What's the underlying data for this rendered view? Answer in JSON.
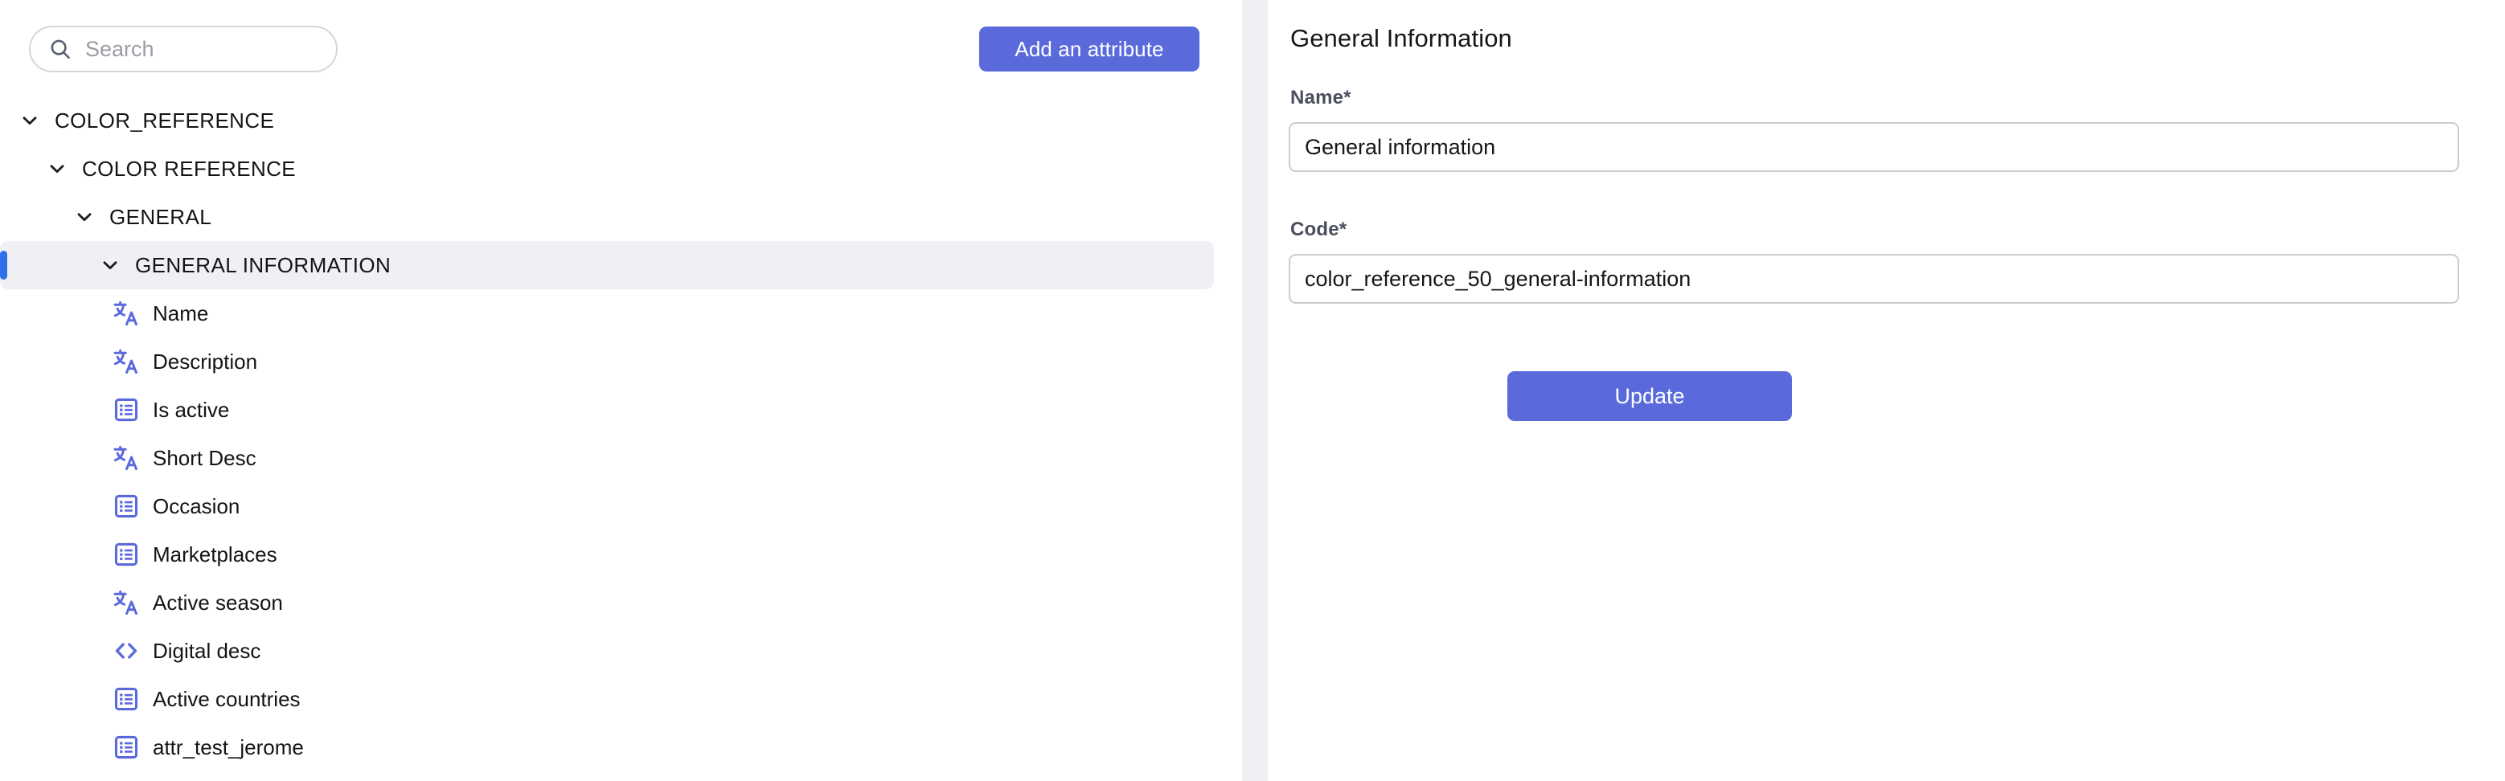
{
  "colors": {
    "accent": "#5a6adb",
    "icon_blue": "#5a6adb",
    "selection_bar": "#2f70e8",
    "selection_bg": "#eff0f4",
    "divider": "#eff0f4",
    "border": "#c9cbd2",
    "text": "#131416",
    "label": "#4a4f5c",
    "placeholder": "#9b9da6"
  },
  "left_panel": {
    "search": {
      "value": "",
      "placeholder": "Search",
      "icon": "search-icon"
    },
    "add_attribute_button": {
      "label": "Add an attribute"
    },
    "tree": [
      {
        "label": "COLOR_REFERENCE",
        "kind": "group",
        "depth": 0,
        "expanded": true,
        "chevron": "chevron-down-icon",
        "selected": false
      },
      {
        "label": "COLOR REFERENCE",
        "kind": "group",
        "depth": 1,
        "expanded": true,
        "chevron": "chevron-down-icon",
        "selected": false
      },
      {
        "label": "GENERAL",
        "kind": "group",
        "depth": 2,
        "expanded": true,
        "chevron": "chevron-down-icon",
        "selected": false
      },
      {
        "label": "GENERAL INFORMATION",
        "kind": "group",
        "depth": 3,
        "expanded": true,
        "chevron": "chevron-down-icon",
        "selected": true
      },
      {
        "label": "Name",
        "kind": "attribute",
        "depth": 4,
        "icon": "translate-icon",
        "selected": false
      },
      {
        "label": "Description",
        "kind": "attribute",
        "depth": 4,
        "icon": "translate-icon",
        "selected": false
      },
      {
        "label": "Is active",
        "kind": "attribute",
        "depth": 4,
        "icon": "list-icon",
        "selected": false
      },
      {
        "label": "Short Desc",
        "kind": "attribute",
        "depth": 4,
        "icon": "translate-icon",
        "selected": false
      },
      {
        "label": "Occasion",
        "kind": "attribute",
        "depth": 4,
        "icon": "list-icon",
        "selected": false
      },
      {
        "label": "Marketplaces",
        "kind": "attribute",
        "depth": 4,
        "icon": "list-icon",
        "selected": false
      },
      {
        "label": "Active season",
        "kind": "attribute",
        "depth": 4,
        "icon": "translate-icon",
        "selected": false
      },
      {
        "label": "Digital desc",
        "kind": "attribute",
        "depth": 4,
        "icon": "code-icon",
        "selected": false
      },
      {
        "label": "Active countries",
        "kind": "attribute",
        "depth": 4,
        "icon": "list-icon",
        "selected": false
      },
      {
        "label": "attr_test_jerome",
        "kind": "attribute",
        "depth": 4,
        "icon": "list-icon",
        "selected": false
      }
    ]
  },
  "right_panel": {
    "title": "General Information",
    "fields": {
      "name_label": "Name*",
      "name_value": "General information",
      "code_label": "Code*",
      "code_value": "color_reference_50_general-information"
    },
    "update_button": {
      "label": "Update"
    }
  }
}
